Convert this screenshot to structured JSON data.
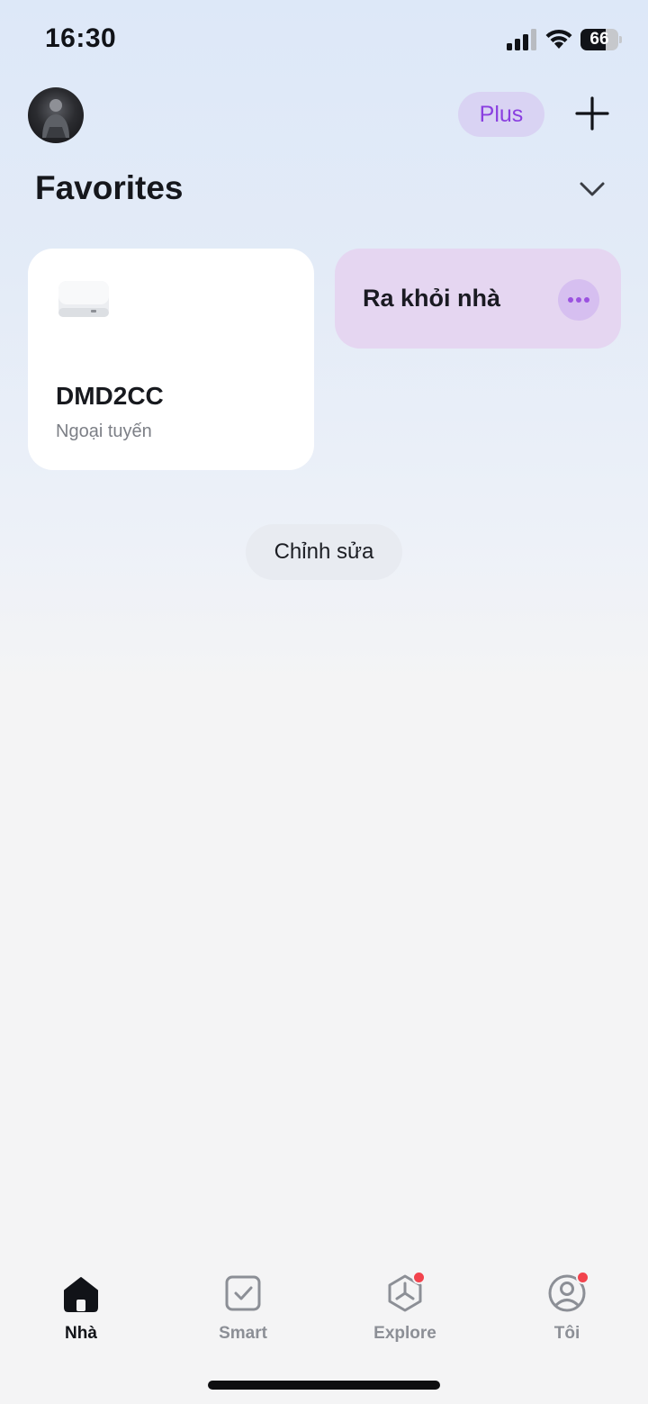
{
  "status_bar": {
    "time": "16:30",
    "battery_level": "66",
    "battery_fraction": 0.66
  },
  "header": {
    "plus_label": "Plus"
  },
  "favorites": {
    "title": "Favorites",
    "device": {
      "name": "DMD2CC",
      "status": "Ngoại tuyến"
    },
    "scene": {
      "name": "Ra khỏi nhà"
    },
    "edit_label": "Chỉnh sửa"
  },
  "tabs": [
    {
      "label": "Nhà",
      "icon": "home-icon",
      "active": true
    },
    {
      "label": "Smart",
      "icon": "checkbox-icon",
      "active": false
    },
    {
      "label": "Explore",
      "icon": "explore-icon",
      "active": false,
      "badge": true
    },
    {
      "label": "Tôi",
      "icon": "profile-icon",
      "active": false,
      "badge": true
    }
  ],
  "colors": {
    "accent_purple": "#8a3fe0",
    "scene_bg": "#e5d6f1",
    "badge_red": "#f2434d"
  }
}
